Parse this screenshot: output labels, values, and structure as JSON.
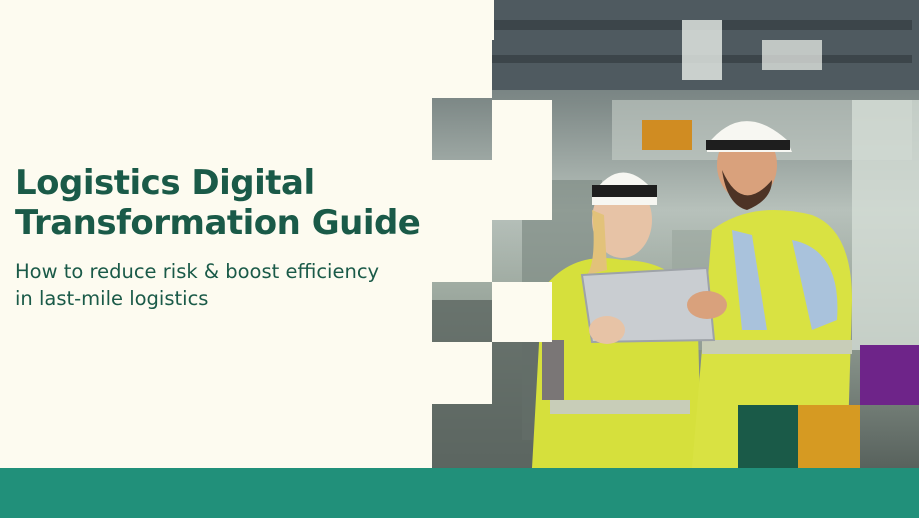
{
  "hero": {
    "title_line1": "Logistics Digital",
    "title_line2": "Transformation Guide",
    "subtitle_line1": "How to reduce risk & boost efficiency",
    "subtitle_line2": "in last-mile logistics"
  },
  "colors": {
    "background": "#fdfbf0",
    "title_green": "#1a5a48",
    "footer_teal": "#21907a",
    "square_purple": "#6e2489",
    "square_dark_green": "#1a5a48",
    "square_gold": "#d69a22"
  },
  "image": {
    "description_icon": "photo-workers-hardhats-tablet"
  }
}
